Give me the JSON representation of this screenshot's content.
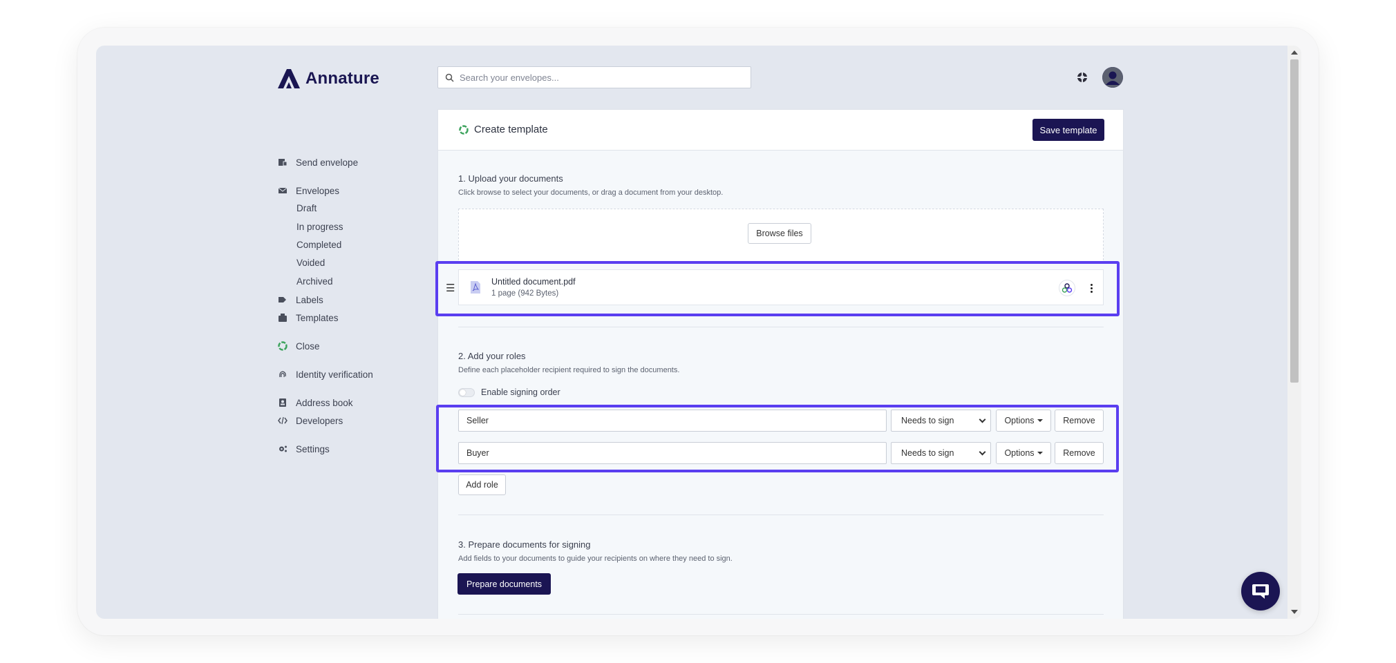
{
  "app": {
    "brand": "Annature",
    "brand_color": "#1b1553",
    "highlight_color": "#5a3ef0"
  },
  "search": {
    "placeholder": "Search your envelopes..."
  },
  "sidebar": {
    "send_envelope": "Send envelope",
    "envelopes": "Envelopes",
    "envelope_subitems": [
      "Draft",
      "In progress",
      "Completed",
      "Voided",
      "Archived"
    ],
    "labels": "Labels",
    "templates": "Templates",
    "close": "Close",
    "identity_verification": "Identity verification",
    "address_book": "Address book",
    "developers": "Developers",
    "settings": "Settings"
  },
  "card": {
    "title": "Create template",
    "save_label": "Save template"
  },
  "upload": {
    "title": "1. Upload your documents",
    "description": "Click browse to select your documents, or drag a document from your desktop.",
    "browse_label": "Browse files",
    "document": {
      "name": "Untitled document.pdf",
      "meta": "1 page (942 Bytes)"
    }
  },
  "roles": {
    "title": "2. Add your roles",
    "description": "Define each placeholder recipient required to sign the documents.",
    "signing_order_label": "Enable signing order",
    "signing_order_enabled": false,
    "items": [
      {
        "name": "Seller",
        "action": "Needs to sign",
        "options_label": "Options",
        "remove_label": "Remove"
      },
      {
        "name": "Buyer",
        "action": "Needs to sign",
        "options_label": "Options",
        "remove_label": "Remove"
      }
    ],
    "add_label": "Add role"
  },
  "prepare": {
    "title": "3. Prepare documents for signing",
    "description": "Add fields to your documents to guide your recipients on where they need to sign.",
    "button_label": "Prepare documents"
  },
  "icons": [
    "search-icon",
    "help-icon",
    "avatar-icon",
    "send-envelope-icon",
    "envelope-icon",
    "label-icon",
    "template-icon",
    "close-icon",
    "fingerprint-icon",
    "address-book-icon",
    "code-icon",
    "gear-icon",
    "pdf-icon",
    "recipients-icon",
    "kebab-icon",
    "chat-icon",
    "drag-handle-icon"
  ]
}
